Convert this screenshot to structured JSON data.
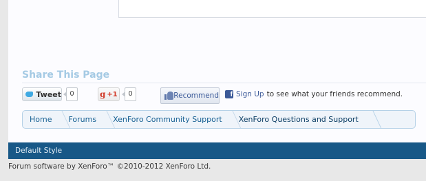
{
  "share": {
    "title": "Share This Page",
    "tweet_label": "Tweet",
    "tweet_count": "0",
    "gplus_label": "+1",
    "gplus_count": "0",
    "recommend_label": "Recommend",
    "signup_link": "Sign Up",
    "signup_text": "to see what your friends recommend."
  },
  "breadcrumb": [
    {
      "label": "Home"
    },
    {
      "label": "Forums"
    },
    {
      "label": "XenForo Community Support"
    },
    {
      "label": "XenForo Questions and Support"
    }
  ],
  "footer": {
    "style_label": "Default Style",
    "copyright": "Forum software by XenForo™ ©2010-2012 XenForo Ltd."
  },
  "colors": {
    "footer_bar": "#185887",
    "share_title": "#a5cae4",
    "breadcrumb_bg": "#eff4fa",
    "link": "#176093",
    "facebook": "#3b5998"
  },
  "icons": [
    "twitter-bird-icon",
    "google-plus-icon",
    "facebook-like-thumb-icon",
    "facebook-icon"
  ]
}
